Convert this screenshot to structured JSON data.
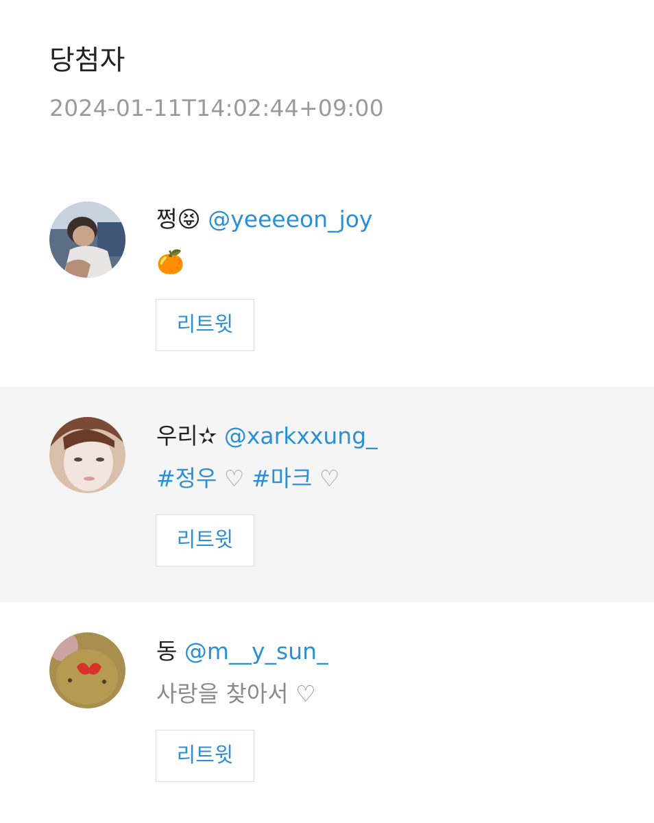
{
  "header": {
    "title": "당첨자",
    "timestamp": "2024-01-11T14:02:44+09:00"
  },
  "winners": [
    {
      "display_name": "쩡😝",
      "handle": "@yeeeeon_joy",
      "bio": "🍊",
      "retweet_label": "리트윗",
      "avatar_icon": "profile-photo-person"
    },
    {
      "display_name": "우리✫",
      "handle": "@xarkxxung_",
      "bio_tag1": "#정우",
      "bio_heart1": " ♡ ",
      "bio_tag2": "#마크",
      "bio_heart2": " ♡",
      "retweet_label": "리트윗",
      "avatar_icon": "profile-photo-face"
    },
    {
      "display_name": "동",
      "handle": "@m__y_sun_",
      "bio": "사랑을 찾아서 ♡",
      "retweet_label": "리트윗",
      "avatar_icon": "profile-photo-plush"
    }
  ],
  "colors": {
    "link_blue": "#2b8fd6",
    "muted_gray": "#9a9a9a",
    "alt_row_bg": "#f5f5f6"
  }
}
